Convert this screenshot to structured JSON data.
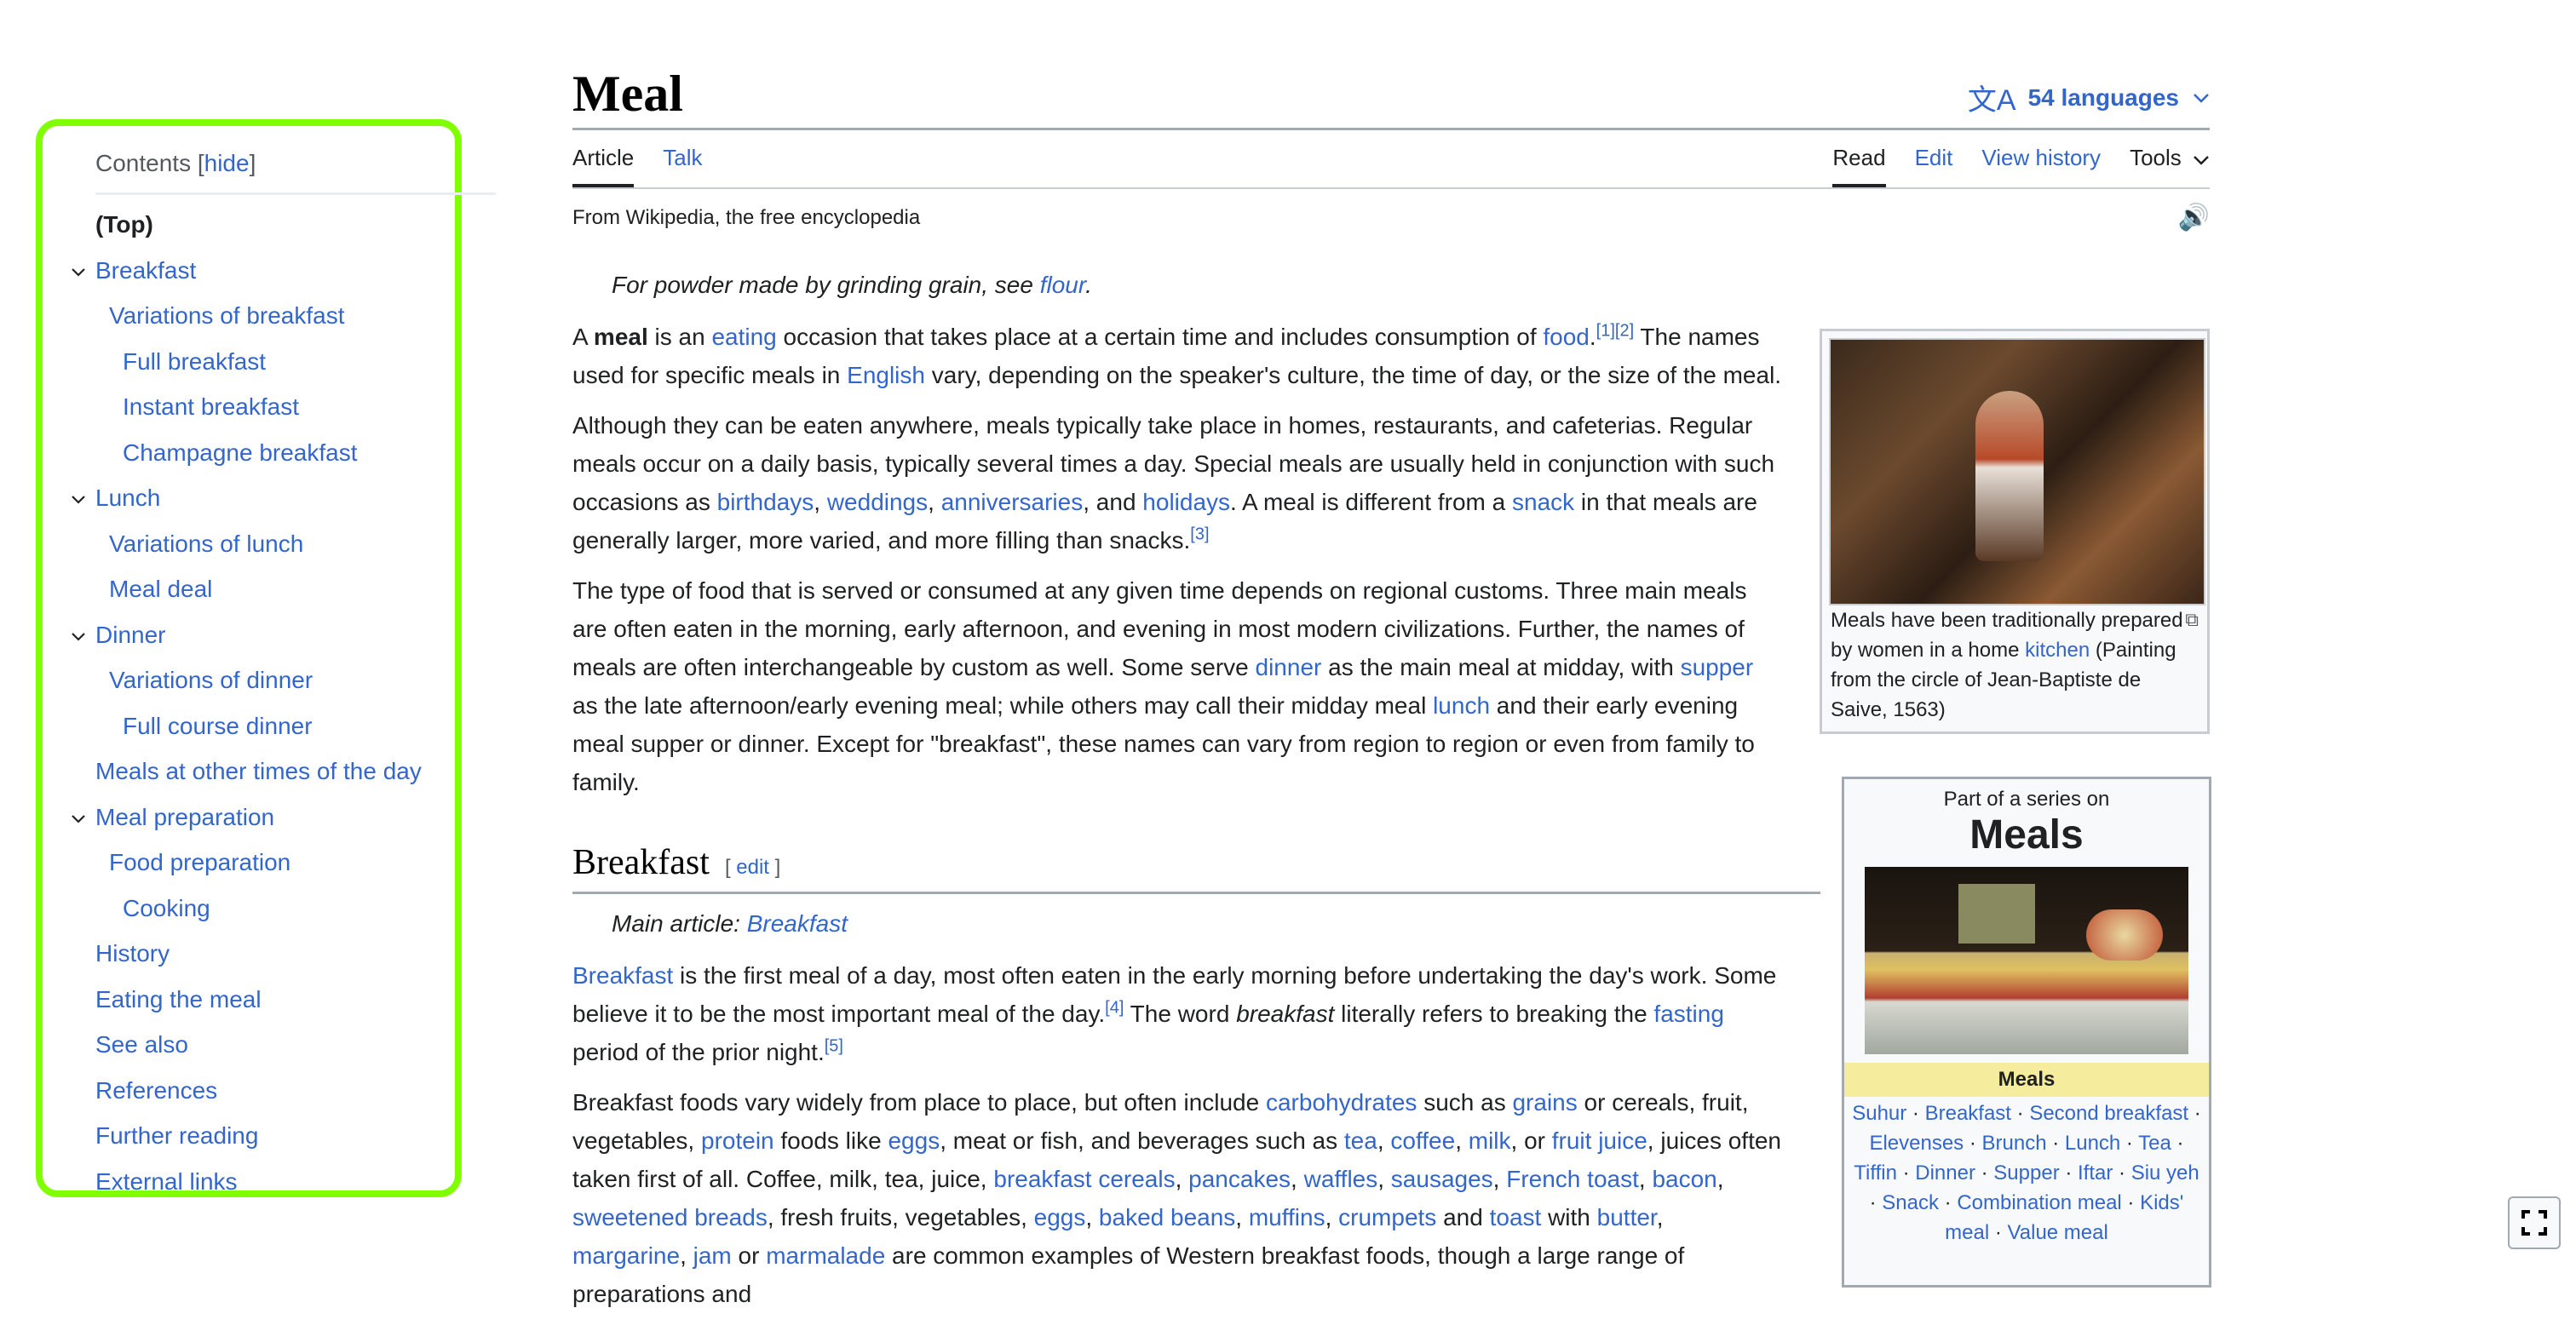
{
  "toc": {
    "heading": "Contents",
    "hide_open": "[",
    "hide_label": "hide",
    "hide_close": "]",
    "items": [
      {
        "label": "(Top)",
        "level": 0,
        "top": true
      },
      {
        "label": "Breakfast",
        "level": 1,
        "chevron": true
      },
      {
        "label": "Variations of breakfast",
        "level": 2
      },
      {
        "label": "Full breakfast",
        "level": 3
      },
      {
        "label": "Instant breakfast",
        "level": 3
      },
      {
        "label": "Champagne breakfast",
        "level": 3
      },
      {
        "label": "Lunch",
        "level": 1,
        "chevron": true
      },
      {
        "label": "Variations of lunch",
        "level": 2
      },
      {
        "label": "Meal deal",
        "level": 2
      },
      {
        "label": "Dinner",
        "level": 1,
        "chevron": true
      },
      {
        "label": "Variations of dinner",
        "level": 2
      },
      {
        "label": "Full course dinner",
        "level": 3
      },
      {
        "label": "Meals at other times of the day",
        "level": 1
      },
      {
        "label": "Meal preparation",
        "level": 1,
        "chevron": true
      },
      {
        "label": "Food preparation",
        "level": 2
      },
      {
        "label": "Cooking",
        "level": 3
      },
      {
        "label": "History",
        "level": 1
      },
      {
        "label": "Eating the meal",
        "level": 1
      },
      {
        "label": "See also",
        "level": 1
      },
      {
        "label": "References",
        "level": 1
      },
      {
        "label": "Further reading",
        "level": 1
      },
      {
        "label": "External links",
        "level": 1
      }
    ]
  },
  "header": {
    "title": "Meal",
    "languages_icon": "translate-icon",
    "languages_label": "54 languages",
    "tabs_left": [
      "Article",
      "Talk"
    ],
    "tabs_right": [
      "Read",
      "Edit",
      "View history"
    ],
    "tools_label": "Tools",
    "tagline": "From Wikipedia, the free encyclopedia",
    "audio_icon": "speaker-icon"
  },
  "article": {
    "hatnote": {
      "text": "For powder made by grinding grain, see ",
      "link": "flour",
      "end": "."
    },
    "p1": {
      "a": "A ",
      "bold": "meal",
      "b": " is an ",
      "l1": "eating",
      "c": " occasion that takes place at a certain time and includes consumption of ",
      "l2": "food",
      "d": ".",
      "ref1": "[1]",
      "ref2": "[2]",
      "e": " The names used for specific meals in ",
      "l3": "English",
      "f": " vary, depending on the speaker's culture, the time of day, or the size of the meal."
    },
    "p2": {
      "a": "Although they can be eaten anywhere, meals typically take place in homes, restaurants, and cafeterias. Regular meals occur on a daily basis, typically several times a day. Special meals are usually held in conjunction with such occasions as ",
      "l1": "birthdays",
      "s1": ", ",
      "l2": "weddings",
      "s2": ", ",
      "l3": "anniversaries",
      "s3": ", and ",
      "l4": "holidays",
      "b": ". A meal is different from a ",
      "l5": "snack",
      "c": " in that meals are generally larger, more varied, and more filling than snacks.",
      "ref": "[3]"
    },
    "p3": {
      "a": "The type of food that is served or consumed at any given time depends on regional customs. Three main meals are often eaten in the morning, early afternoon, and evening in most modern civilizations. Further, the names of meals are often interchangeable by custom as well. Some serve ",
      "l1": "dinner",
      "b": " as the main meal at midday, with ",
      "l2": "supper",
      "c": " as the late afternoon/early evening meal; while others may call their midday meal ",
      "l3": "lunch",
      "d": " and their early evening meal supper or dinner. Except for \"breakfast\", these names can vary from region to region or even from family to family."
    },
    "section_breakfast": {
      "heading": "Breakfast",
      "edit_open": "[ ",
      "edit_label": "edit",
      "edit_close": " ]",
      "hatnote_prefix": "Main article: ",
      "hatnote_link": "Breakfast",
      "p1": {
        "l1": "Breakfast",
        "a": " is the first meal of a day, most often eaten in the early morning before undertaking the day's work. Some believe it to be the most important meal of the day.",
        "ref1": "[4]",
        "b": " The word ",
        "em": "breakfast",
        "c": " literally refers to breaking the ",
        "l2": "fasting",
        "d": " period of the prior night.",
        "ref2": "[5]"
      },
      "p2": {
        "a": "Breakfast foods vary widely from place to place, but often include ",
        "links": [
          "carbohydrates",
          "grains",
          "protein",
          "eggs",
          "tea",
          "coffee",
          "milk",
          "fruit juice",
          "breakfast cereals",
          "pancakes",
          "waffles",
          "sausages",
          "French toast",
          "bacon",
          "sweetened breads",
          "eggs",
          "baked beans",
          "muffins",
          "crumpets",
          "toast",
          "butter",
          "margarine",
          "jam",
          "marmalade"
        ],
        "t1": " such as ",
        "t2": " or cereals, fruit, vegetables, ",
        "t3": " foods like ",
        "t4": ", meat or fish, and beverages such as ",
        "c": ", ",
        "t5": ", or ",
        "t6": ", juices often taken first of all. Coffee, milk, tea, juice, ",
        "t7": ", fresh fruits, vegetables, ",
        "t8": " and ",
        "t9": " with ",
        "t10": " or ",
        "t11": " are common examples of Western breakfast foods, though a large range of preparations and"
      }
    }
  },
  "thumbnail": {
    "caption_a": "Meals have been traditionally prepared by women in a home ",
    "caption_link": "kitchen",
    "caption_b": " (Painting from the circle of Jean-Baptiste de Saive, 1563)",
    "magnify_icon": "magnify-icon"
  },
  "infobox": {
    "pretitle": "Part of a series on",
    "title": "Meals",
    "group_heading": "Meals",
    "links": [
      "Suhur",
      "Breakfast",
      "Second breakfast",
      "Elevenses",
      "Brunch",
      "Lunch",
      "Tea",
      "Tiffin",
      "Dinner",
      "Supper",
      "Iftar",
      "Siu yeh",
      "Snack",
      "Combination meal",
      "Kids' meal",
      "Value meal"
    ]
  },
  "colors": {
    "link": "#3366cc",
    "toc_highlight": "#80ff00",
    "infobox_header": "#f5ec9e"
  }
}
